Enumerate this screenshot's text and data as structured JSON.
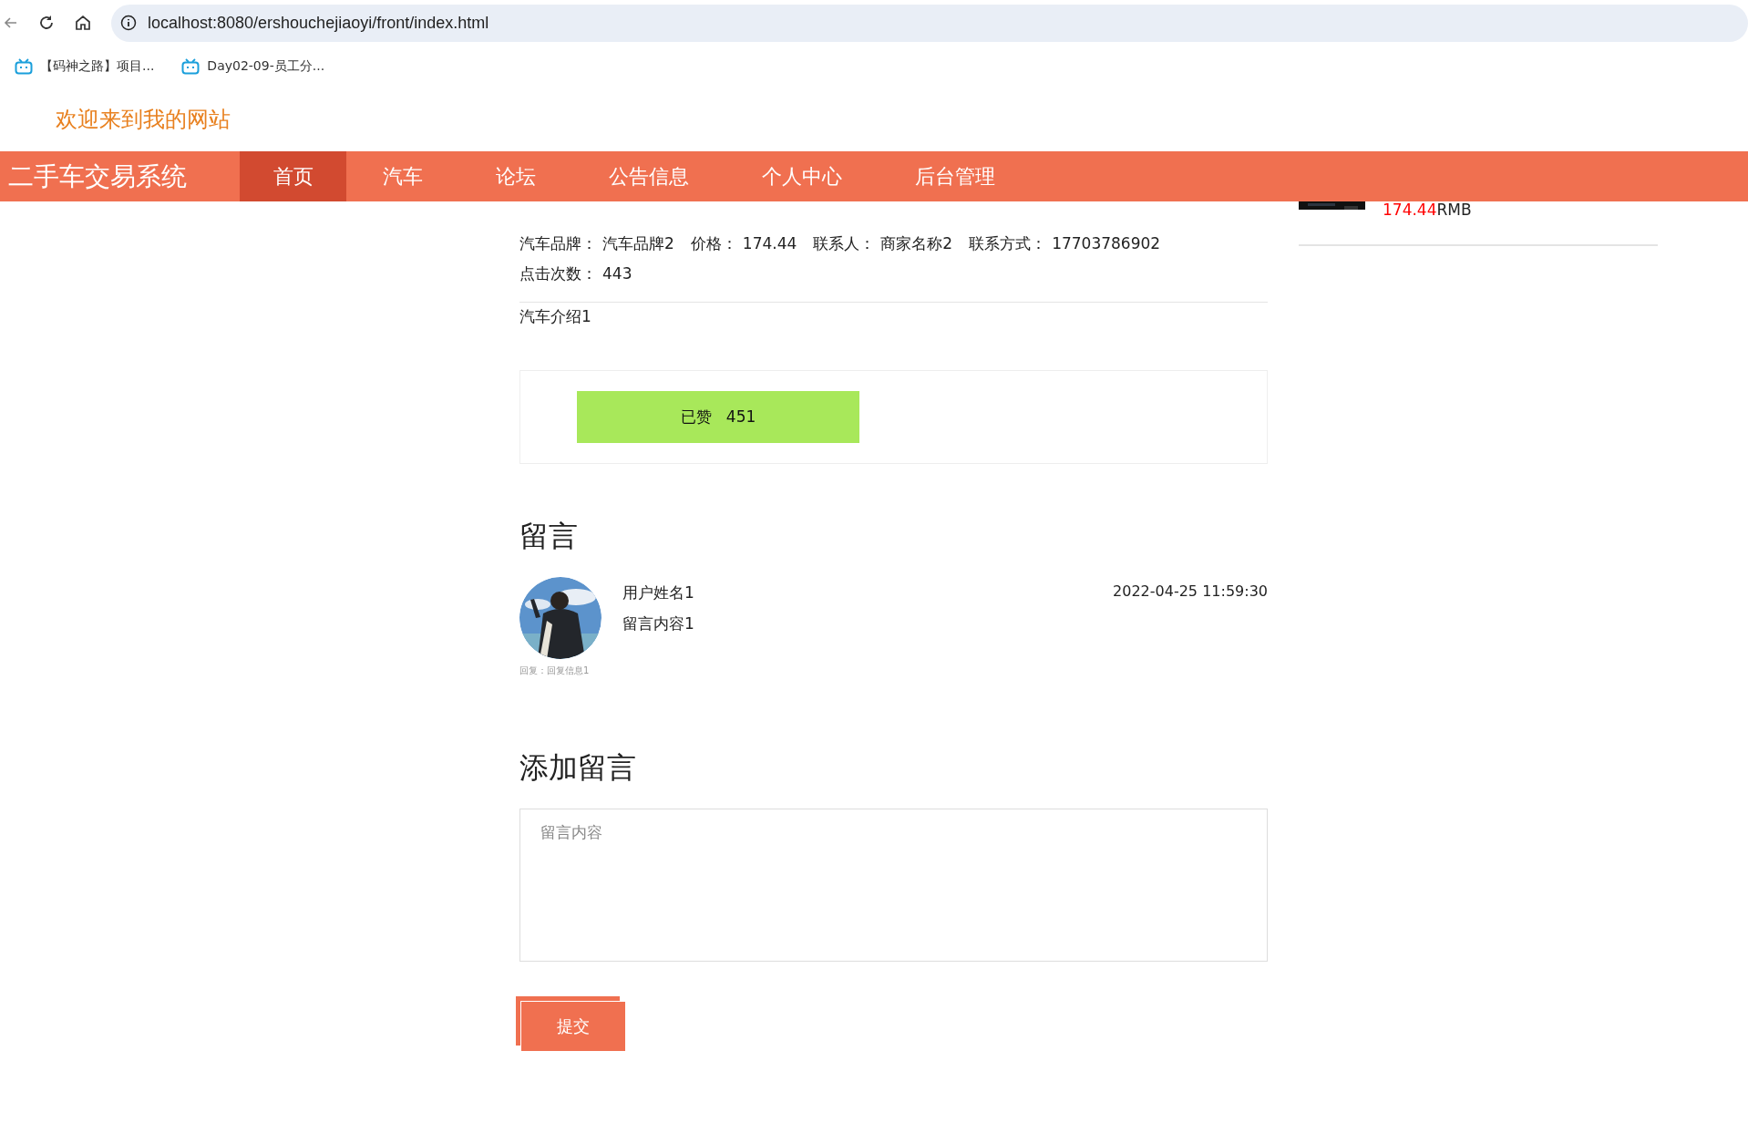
{
  "browser": {
    "url": "localhost:8080/ershouchejiaoyi/front/index.html",
    "bookmarks": [
      {
        "label": "【码神之路】项目..."
      },
      {
        "label": "Day02-09-员工分..."
      }
    ]
  },
  "header": {
    "welcome": "欢迎来到我的网站"
  },
  "nav": {
    "brand": "二手车交易系统",
    "items": [
      {
        "label": "首页",
        "selected": true
      },
      {
        "label": "汽车",
        "selected": false
      },
      {
        "label": "论坛",
        "selected": false
      },
      {
        "label": "公告信息",
        "selected": false
      },
      {
        "label": "个人中心",
        "selected": false
      },
      {
        "label": "后台管理",
        "selected": false
      }
    ]
  },
  "car": {
    "rows": [
      {
        "fields": [
          {
            "label": "汽车品牌：",
            "value": "汽车品牌2"
          },
          {
            "label": "价格：",
            "value": "174.44"
          },
          {
            "label": "联系人：",
            "value": "商家名称2"
          },
          {
            "label": "联系方式：",
            "value": "17703786902"
          }
        ]
      },
      {
        "fields": [
          {
            "label": "点击次数：",
            "value": "443"
          }
        ]
      }
    ],
    "intro": "汽车介绍1",
    "like": {
      "label": "已赞",
      "count": "451"
    }
  },
  "comments": {
    "heading": "留言",
    "items": [
      {
        "user": "用户姓名1",
        "content": "留言内容1",
        "time": "2022-04-25 11:59:30",
        "reply": "回复：回复信息1"
      }
    ]
  },
  "add_comment": {
    "heading": "添加留言",
    "placeholder": "留言内容",
    "submit": "提交"
  },
  "sidebar": {
    "price": "174.44",
    "unit": "RMB"
  }
}
